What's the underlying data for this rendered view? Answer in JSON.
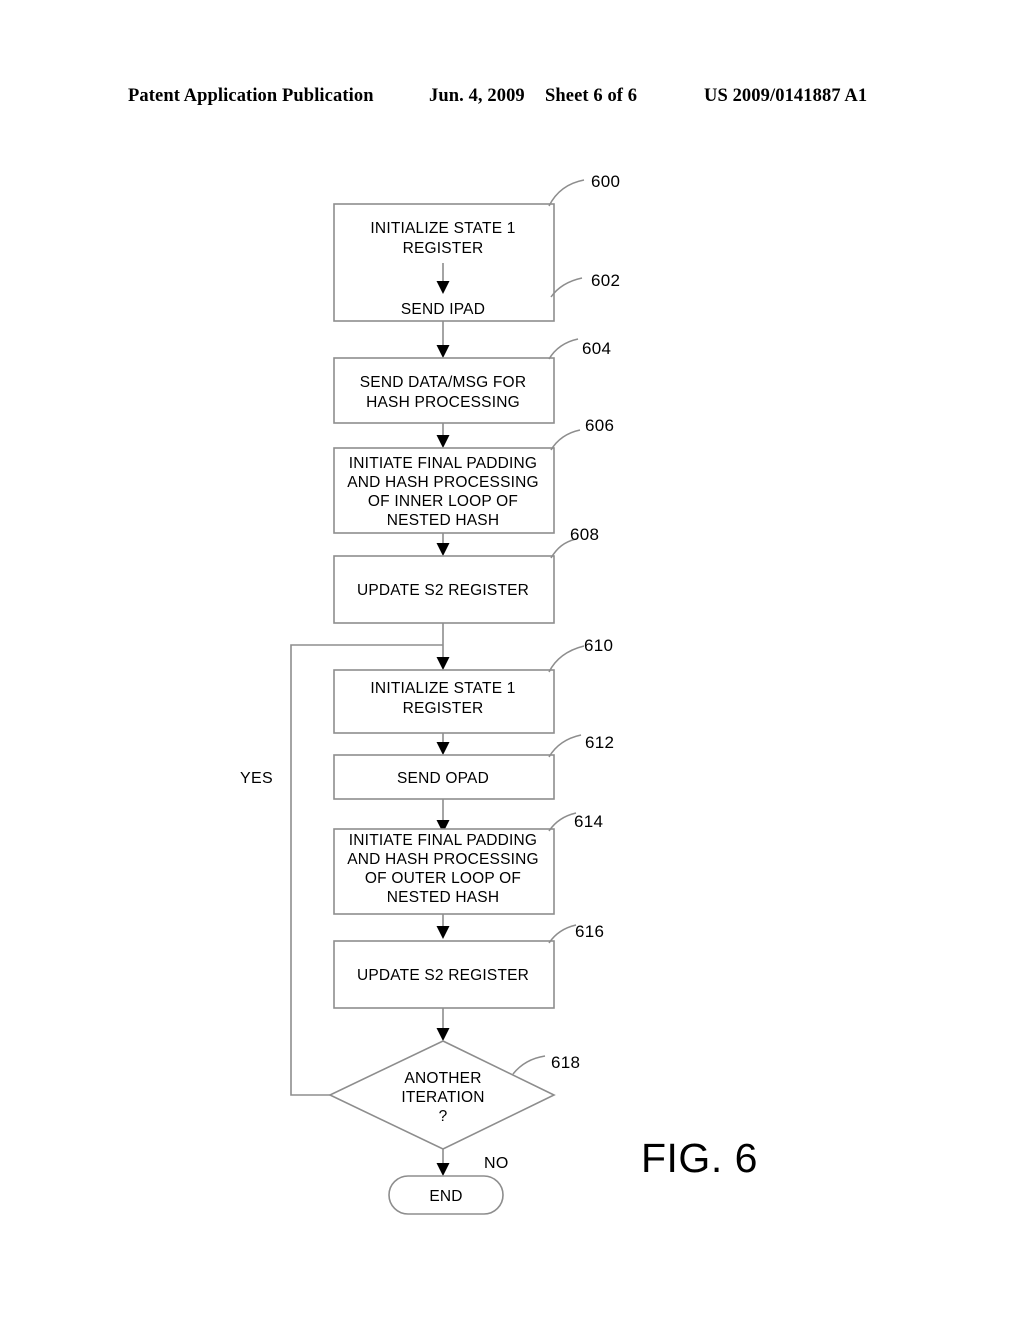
{
  "header": {
    "publication": "Patent Application Publication",
    "date": "Jun. 4, 2009",
    "sheet": "Sheet 6 of 6",
    "patent_number": "US 2009/0141887 A1"
  },
  "figure": {
    "caption": "FIG. 6",
    "line_color": "#8d8d8d",
    "text_color": "#000000"
  },
  "flowchart": {
    "nodes": [
      {
        "ref": "600",
        "type": "process",
        "lines": [
          "INITIALIZE STATE 1",
          "REGISTER"
        ]
      },
      {
        "ref": "602",
        "type": "process",
        "lines": [
          "SEND IPAD"
        ]
      },
      {
        "ref": "604",
        "type": "process",
        "lines": [
          "SEND DATA/MSG FOR",
          "HASH PROCESSING"
        ]
      },
      {
        "ref": "606",
        "type": "process",
        "lines": [
          "INITIATE FINAL PADDING",
          "AND HASH PROCESSING",
          "OF INNER LOOP OF",
          "NESTED HASH"
        ]
      },
      {
        "ref": "608",
        "type": "process",
        "lines": [
          "UPDATE S2 REGISTER"
        ]
      },
      {
        "ref": "610",
        "type": "process",
        "lines": [
          "INITIALIZE STATE 1",
          "REGISTER"
        ]
      },
      {
        "ref": "612",
        "type": "process",
        "lines": [
          "SEND OPAD"
        ]
      },
      {
        "ref": "614",
        "type": "process",
        "lines": [
          "INITIATE FINAL PADDING",
          "AND HASH PROCESSING",
          "OF OUTER  LOOP OF",
          "NESTED HASH"
        ]
      },
      {
        "ref": "616",
        "type": "process",
        "lines": [
          "UPDATE S2 REGISTER"
        ]
      },
      {
        "ref": "618",
        "type": "decision",
        "lines": [
          "ANOTHER",
          "ITERATION",
          "?"
        ]
      },
      {
        "ref": "",
        "type": "terminal",
        "lines": [
          "END"
        ]
      }
    ],
    "branch_labels": {
      "yes": "YES",
      "no": "NO"
    }
  }
}
